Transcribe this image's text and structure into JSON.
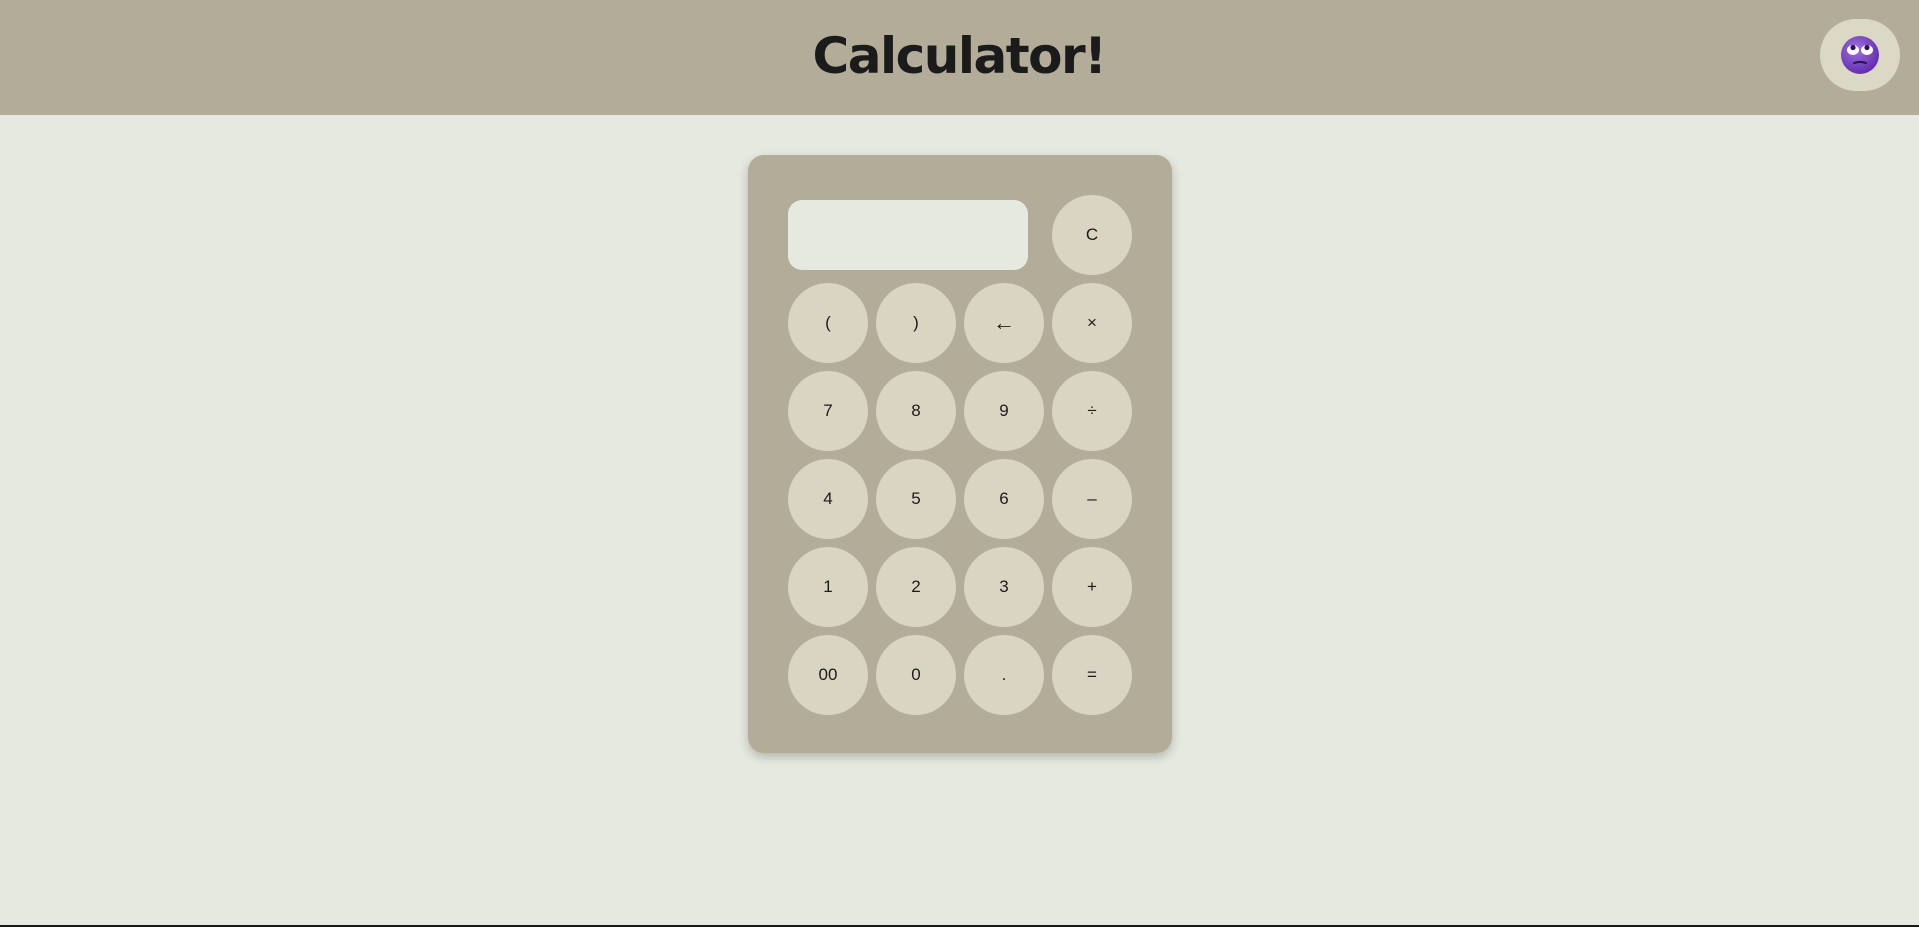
{
  "header": {
    "title": "Calculator!"
  },
  "theme_toggle": {
    "icon": "face-with-rolling-eyes-icon",
    "color": "#7b3fc4"
  },
  "display": {
    "value": ""
  },
  "keys": {
    "clear": "C",
    "open_paren": "(",
    "close_paren": ")",
    "backspace": "←",
    "multiply": "×",
    "seven": "7",
    "eight": "8",
    "nine": "9",
    "divide": "÷",
    "four": "4",
    "five": "5",
    "six": "6",
    "minus": "–",
    "one": "1",
    "two": "2",
    "three": "3",
    "plus": "+",
    "double_zero": "00",
    "zero": "0",
    "decimal": ".",
    "equals": "="
  },
  "colors": {
    "header_bg": "#b3ac99",
    "page_bg": "#e6e9df",
    "key_bg": "#d9d5c2",
    "text": "#1b1b1b"
  }
}
